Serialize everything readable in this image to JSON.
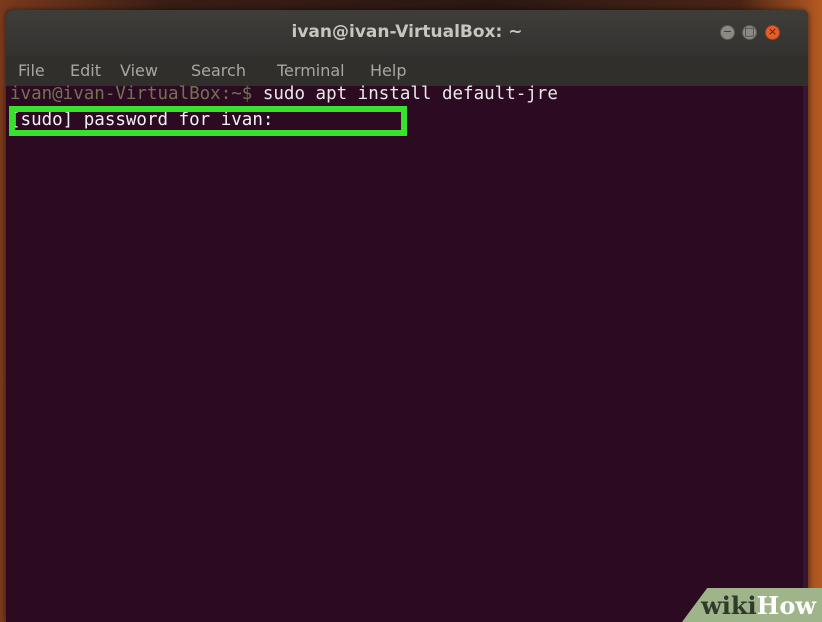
{
  "window": {
    "title": "ivan@ivan-VirtualBox: ~",
    "buttons": {
      "minimize": "−",
      "maximize": "□",
      "close": "×"
    }
  },
  "menubar": {
    "items": [
      {
        "label": "File"
      },
      {
        "label": "Edit"
      },
      {
        "label": "View"
      },
      {
        "label": "Search"
      },
      {
        "label": "Terminal"
      },
      {
        "label": "Help"
      }
    ]
  },
  "terminal": {
    "prompt": "ivan@ivan-VirtualBox:~$",
    "command": " sudo apt install default-jre",
    "password_prompt": "[sudo] password for ivan:"
  },
  "watermark": {
    "wiki": "wiki",
    "how": "How"
  },
  "colors": {
    "highlight": "#39e12c",
    "terminal_bg": "#2c0a22",
    "close_button": "#e25f2b"
  }
}
